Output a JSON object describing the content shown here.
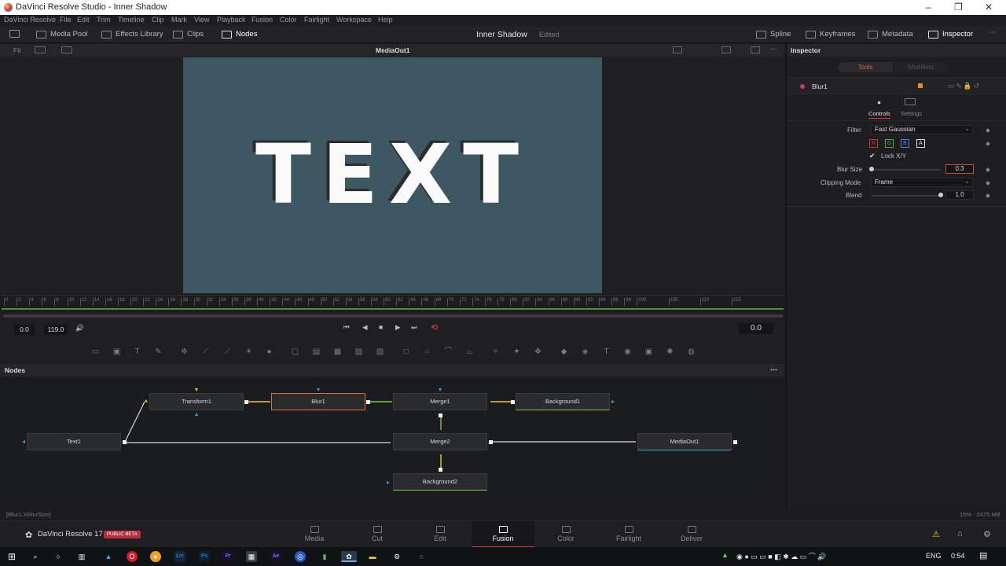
{
  "window": {
    "title": "DaVinci Resolve Studio - Inner Shadow",
    "controls": [
      "–",
      "❐",
      "✕"
    ]
  },
  "menu": [
    "DaVinci Resolve",
    "File",
    "Edit",
    "Trim",
    "Timeline",
    "Clip",
    "Mark",
    "View",
    "Playback",
    "Fusion",
    "Color",
    "Fairlight",
    "Workspace",
    "Help"
  ],
  "toolbar": {
    "media_pool": "Media Pool",
    "effects_library": "Effects Library",
    "clips": "Clips",
    "nodes": "Nodes",
    "project_name": "Inner Shadow",
    "project_status": "Edited",
    "spline": "Spline",
    "keyframes": "Keyframes",
    "metadata": "Metadata",
    "inspector": "Inspector"
  },
  "viewer": {
    "fit_label": "Fit",
    "viewer_title": "MediaOut1",
    "canvas_text": "TEXT",
    "canvas_bg": "#3d5763"
  },
  "ruler": {
    "ticks": [
      "0",
      "2",
      "4",
      "6",
      "8",
      "10",
      "12",
      "14",
      "16",
      "18",
      "20",
      "22",
      "24",
      "26",
      "28",
      "30",
      "32",
      "34",
      "36",
      "38",
      "40",
      "42",
      "44",
      "46",
      "48",
      "50",
      "52",
      "54",
      "56",
      "58",
      "60",
      "62",
      "64",
      "66",
      "68",
      "70",
      "72",
      "74",
      "76",
      "78",
      "80",
      "82",
      "84",
      "86",
      "88",
      "90",
      "92",
      "94",
      "96",
      "98",
      "100",
      "105",
      "110",
      "115"
    ]
  },
  "playback": {
    "start": "0.0",
    "end": "119.0",
    "current": "0.0"
  },
  "nodes_panel": {
    "title": "Nodes",
    "more": "•••",
    "nodes": [
      {
        "id": "transform1",
        "label": "Transform1"
      },
      {
        "id": "blur1",
        "label": "Blur1"
      },
      {
        "id": "merge1",
        "label": "Merge1"
      },
      {
        "id": "background1",
        "label": "Background1"
      },
      {
        "id": "text1",
        "label": "Text1"
      },
      {
        "id": "merge2",
        "label": "Merge2"
      },
      {
        "id": "mediaout1",
        "label": "MediaOut1"
      },
      {
        "id": "background2",
        "label": "Background2"
      }
    ]
  },
  "inspector": {
    "title": "Inspector",
    "tabs": [
      "Tools",
      "Modifiers"
    ],
    "tool_name": "Blur1",
    "subtabs": [
      "Controls",
      "Settings"
    ],
    "filter_label": "Filter",
    "filter_value": "Fast Gaussian",
    "channels": [
      "R",
      "G",
      "B",
      "A"
    ],
    "lock_label": "Lock X/Y",
    "blur_size_label": "Blur Size",
    "blur_size_value": "0.3",
    "blur_size_fraction": 0.0,
    "clipping_label": "Clipping Mode",
    "clipping_value": "Frame",
    "blend_label": "Blend",
    "blend_value": "1.0",
    "blend_fraction": 1.0
  },
  "status": {
    "left": "[Blur1.XBlurSize]",
    "right": "15% - 2475 MB"
  },
  "app": {
    "name": "DaVinci Resolve 17",
    "badge": "PUBLIC BETA"
  },
  "pages": [
    "Media",
    "Cut",
    "Edit",
    "Fusion",
    "Color",
    "Fairlight",
    "Deliver"
  ],
  "active_page": "Fusion",
  "taskbar": {
    "lang": "ENG",
    "time": "0:54"
  },
  "colors": {
    "accent": "#d13c4f",
    "selected_node": "#d9733a",
    "link_yellow": "#e8c93a",
    "link_green": "#7ac943",
    "link_blue": "#3aa0e8"
  }
}
